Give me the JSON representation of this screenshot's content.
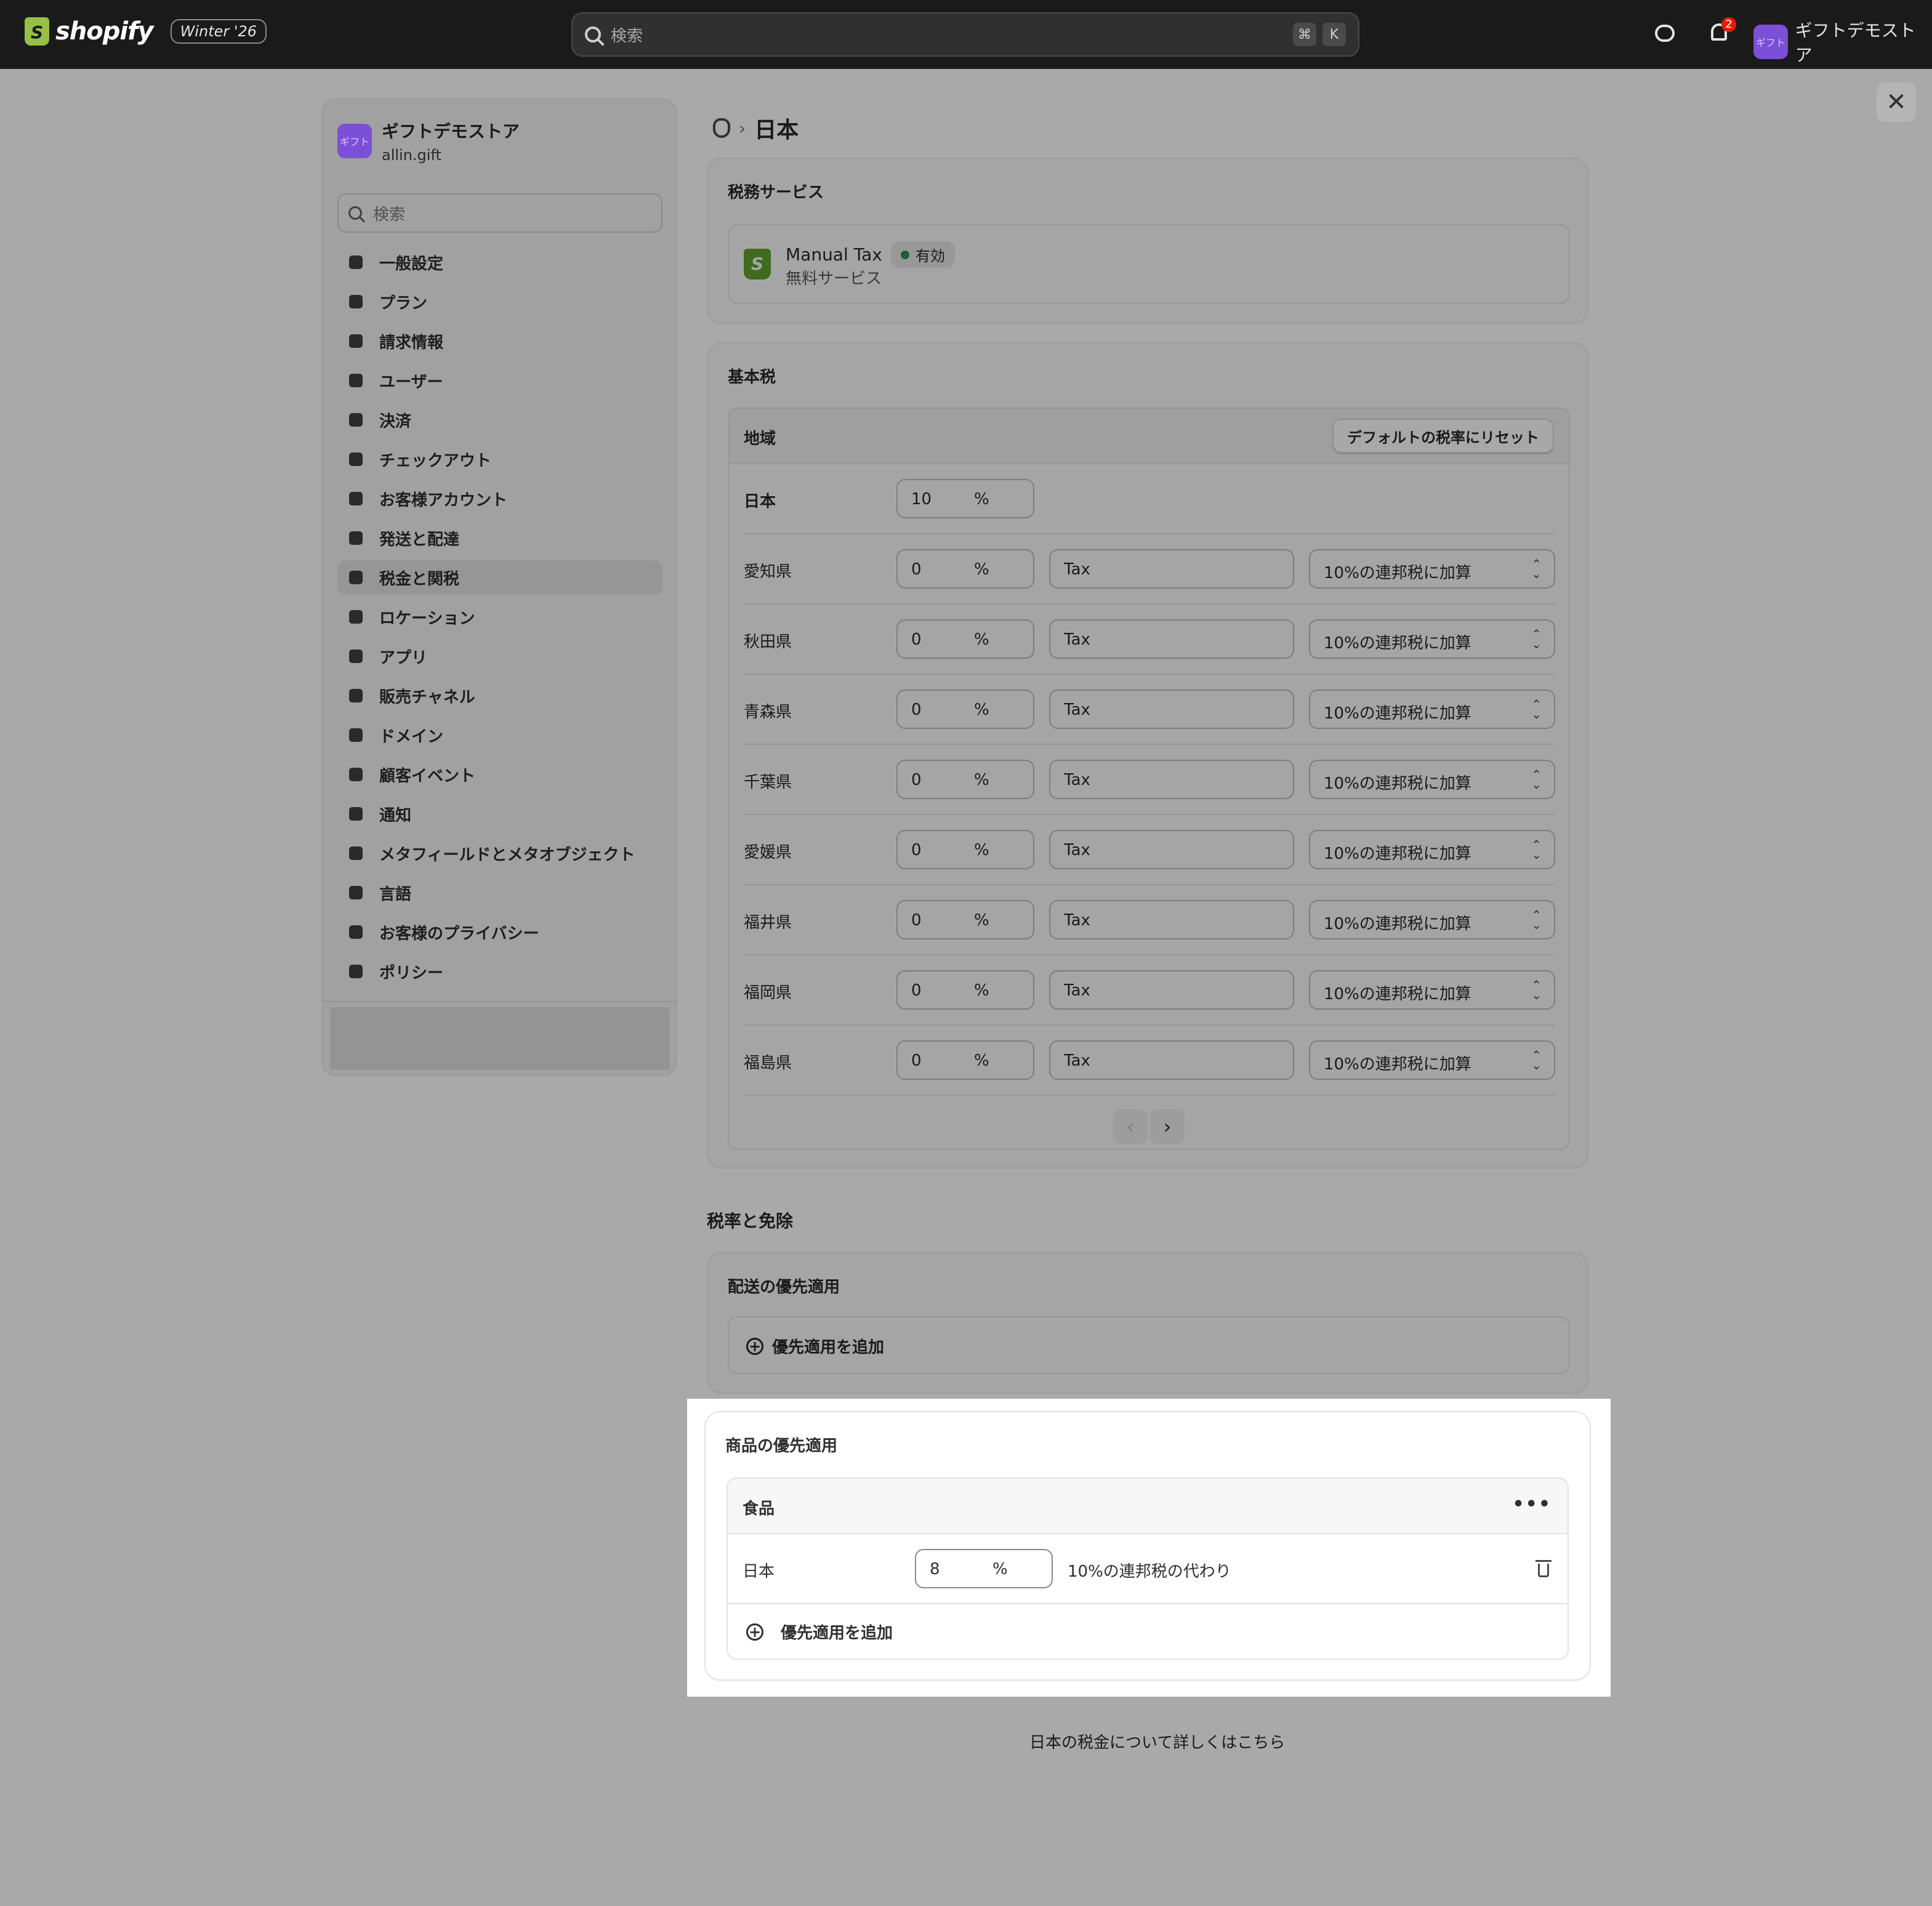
{
  "topbar": {
    "brand": "shopify",
    "edition": "Winter '26",
    "search_placeholder": "検索",
    "shortcut_keys": [
      "⌘",
      "K"
    ],
    "notification_count": "2",
    "store_avatar": "ギフト",
    "store_name": "ギフトデモストア"
  },
  "sidebar": {
    "avatar": "ギフト",
    "store_name": "ギフトデモストア",
    "domain": "allin.gift",
    "search_placeholder": "検索",
    "items": [
      {
        "label": "一般設定",
        "icon": "store-icon"
      },
      {
        "label": "プラン",
        "icon": "plan-icon"
      },
      {
        "label": "請求情報",
        "icon": "billing-icon"
      },
      {
        "label": "ユーザー",
        "icon": "users-icon"
      },
      {
        "label": "決済",
        "icon": "payments-icon"
      },
      {
        "label": "チェックアウト",
        "icon": "cart-icon"
      },
      {
        "label": "お客様アカウント",
        "icon": "person-icon"
      },
      {
        "label": "発送と配達",
        "icon": "truck-icon"
      },
      {
        "label": "税金と関税",
        "icon": "tax-icon",
        "active": true
      },
      {
        "label": "ロケーション",
        "icon": "location-icon"
      },
      {
        "label": "アプリ",
        "icon": "apps-icon"
      },
      {
        "label": "販売チャネル",
        "icon": "channels-icon"
      },
      {
        "label": "ドメイン",
        "icon": "domain-icon"
      },
      {
        "label": "顧客イベント",
        "icon": "events-icon"
      },
      {
        "label": "通知",
        "icon": "bell-icon"
      },
      {
        "label": "メタフィールドとメタオブジェクト",
        "icon": "metafields-icon"
      },
      {
        "label": "言語",
        "icon": "language-icon"
      },
      {
        "label": "お客様のプライバシー",
        "icon": "lock-icon"
      },
      {
        "label": "ポリシー",
        "icon": "policy-icon"
      }
    ]
  },
  "breadcrumb": {
    "current": "日本",
    "separator": "›"
  },
  "tax_service": {
    "title": "税務サービス",
    "name": "Manual Tax",
    "status": "有効",
    "subtitle": "無料サービス"
  },
  "base_tax": {
    "title": "基本税",
    "column_region": "地域",
    "reset_label": "デフォルトの税率にリセット",
    "country": {
      "region": "日本",
      "rate": "10",
      "unit": "%"
    },
    "rows": [
      {
        "region": "愛知県",
        "rate": "0",
        "unit": "%",
        "name": "Tax",
        "mode": "10%の連邦税に加算"
      },
      {
        "region": "秋田県",
        "rate": "0",
        "unit": "%",
        "name": "Tax",
        "mode": "10%の連邦税に加算"
      },
      {
        "region": "青森県",
        "rate": "0",
        "unit": "%",
        "name": "Tax",
        "mode": "10%の連邦税に加算"
      },
      {
        "region": "千葉県",
        "rate": "0",
        "unit": "%",
        "name": "Tax",
        "mode": "10%の連邦税に加算"
      },
      {
        "region": "愛媛県",
        "rate": "0",
        "unit": "%",
        "name": "Tax",
        "mode": "10%の連邦税に加算"
      },
      {
        "region": "福井県",
        "rate": "0",
        "unit": "%",
        "name": "Tax",
        "mode": "10%の連邦税に加算"
      },
      {
        "region": "福岡県",
        "rate": "0",
        "unit": "%",
        "name": "Tax",
        "mode": "10%の連邦税に加算"
      },
      {
        "region": "福島県",
        "rate": "0",
        "unit": "%",
        "name": "Tax",
        "mode": "10%の連邦税に加算"
      }
    ],
    "pager": {
      "prev": "‹",
      "next": "›"
    }
  },
  "rates_section": {
    "title": "税率と免除"
  },
  "shipping_override": {
    "title": "配送の優先適用",
    "add_label": "優先適用を追加"
  },
  "product_override": {
    "title": "商品の優先適用",
    "collection": "食品",
    "more": "•••",
    "row": {
      "region": "日本",
      "rate": "8",
      "unit": "%",
      "description": "10%の連邦税の代わり"
    },
    "add_label": "優先適用を追加"
  },
  "learn_more": "日本の税金について詳しくはこちら",
  "close_label": "✕"
}
